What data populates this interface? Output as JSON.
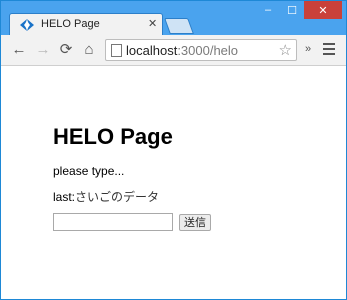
{
  "browser": {
    "tab_title": "HELO Page",
    "close_glyph": "✕",
    "url_host": "localhost",
    "url_rest": ":3000/helo",
    "back_icon": "←",
    "forward_icon": "→",
    "reload_icon": "⟳",
    "home_icon": "⌂",
    "star_icon": "☆",
    "extensions_icon": "»",
    "minimize_icon": "–",
    "maximize_icon": "☐",
    "window_close_icon": "✕",
    "frame_color": "#4aa3ee"
  },
  "page": {
    "title": "HELO Page",
    "message": "please type...",
    "last_label": "last:",
    "last_value": "さいごのデータ",
    "input_value": "",
    "submit_label": "送信"
  }
}
